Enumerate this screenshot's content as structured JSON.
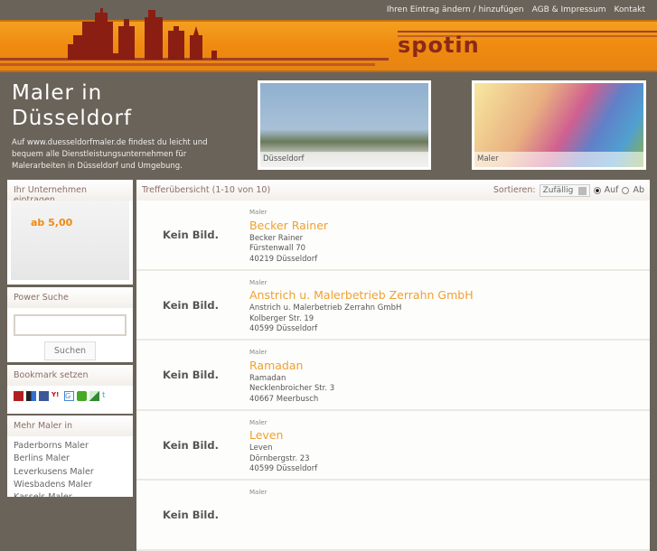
{
  "topnav": [
    "Ihren Eintrag ändern / hinzufügen",
    "AGB & Impressum",
    "Kontakt"
  ],
  "logo": "spotin",
  "hero": {
    "title_line1": "Maler in",
    "title_line2": "Düsseldorf",
    "description": "Auf www.duesseldorfmaler.de findest du leicht und bequem alle Dienstleistungsunternehmen für Malerarbeiten in Düsseldorf und Umgebung.",
    "photo1_caption": "Düsseldorf",
    "photo2_caption": "Maler"
  },
  "sidebar": {
    "register": {
      "title": "Ihr Unternehmen eintragen",
      "ad_price": "ab 5,00"
    },
    "search": {
      "title": "Power Suche",
      "value": "",
      "button": "Suchen"
    },
    "bookmark": {
      "title": "Bookmark setzen",
      "icons": [
        "mister-wong-icon",
        "delicious-icon",
        "facebook-icon",
        "yahoo-icon",
        "google-icon",
        "linkarena-icon",
        "oneview-icon",
        "twitter-icon"
      ]
    },
    "more": {
      "title": "Mehr Maler in",
      "links": [
        "Paderborns Maler",
        "Berlins Maler",
        "Leverkusens Maler",
        "Wiesbadens Maler",
        "Kassels Maler"
      ]
    }
  },
  "results": {
    "header": "Trefferübersicht (1-10 von 10)",
    "sort_label": "Sortieren:",
    "sort_value": "Zufällig",
    "asc": "Auf",
    "desc": "Ab",
    "no_image": "Kein Bild.",
    "items": [
      {
        "category": "Maler",
        "name": "Becker Rainer",
        "line1": "Becker Rainer",
        "line2": "Fürstenwall 70",
        "line3": "40219 Düsseldorf"
      },
      {
        "category": "Maler",
        "name": "Anstrich u. Malerbetrieb Zerrahn GmbH",
        "line1": "Anstrich u. Malerbetrieb Zerrahn GmbH",
        "line2": "Kolberger Str. 19",
        "line3": "40599 Düsseldorf"
      },
      {
        "category": "Maler",
        "name": "Ramadan",
        "line1": "Ramadan",
        "line2": "Necklenbroicher Str. 3",
        "line3": "40667 Meerbusch"
      },
      {
        "category": "Maler",
        "name": "Leven",
        "line1": "Leven",
        "line2": "Dörnbergstr. 23",
        "line3": "40599 Düsseldorf"
      },
      {
        "category": "Maler",
        "name": "",
        "line1": "",
        "line2": "",
        "line3": ""
      }
    ]
  }
}
